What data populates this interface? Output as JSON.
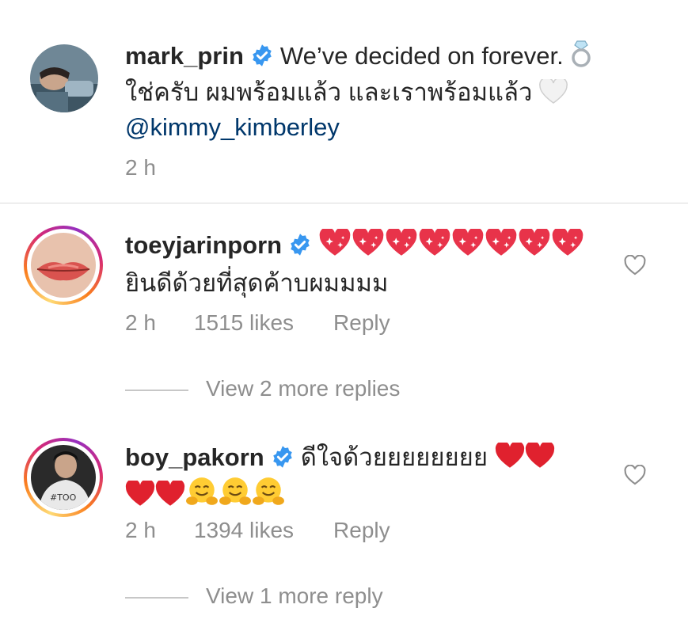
{
  "post_caption": {
    "username": "mark_prin",
    "text_line1": "We’ve decided on forever.",
    "text_line2": "ใช่ครับ ผมพร้อมแล้ว และเราพร้อมแล้ว",
    "mention": "@kimmy_kimberley",
    "time": "2 h",
    "icons": [
      "verified-badge-icon",
      "ring-emoji-icon",
      "white-heart-emoji-icon"
    ]
  },
  "comments": [
    {
      "username": "toeyjarinporn",
      "emoji_line": "sparkling-heart x8",
      "text": "ยินดีด้วยที่สุดค้าบผมมมม",
      "time": "2 h",
      "likes": "1515 likes",
      "reply_label": "Reply",
      "view_more": "View 2 more replies"
    },
    {
      "username": "boy_pakorn",
      "text": "ดีใจด้วยยยยยยยย",
      "time": "2 h",
      "likes": "1394 likes",
      "reply_label": "Reply",
      "view_more": "View 1 more reply"
    }
  ],
  "colors": {
    "verified_blue": "#3897f0",
    "text": "#262626",
    "muted": "#8e8e8e",
    "mention": "#00376b",
    "heart_red": "#e0212e",
    "sparkle_heart": "#e8334a"
  }
}
